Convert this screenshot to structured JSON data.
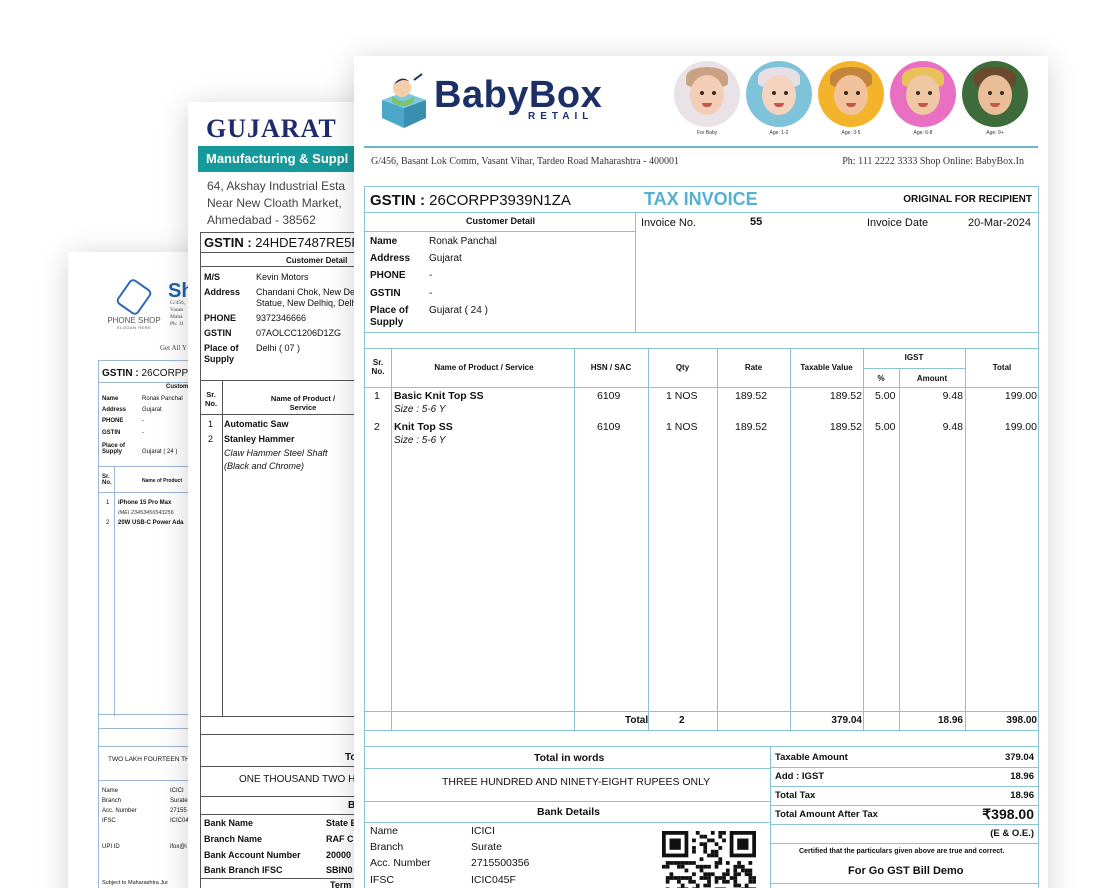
{
  "doc1": {
    "logo_text": "PHONE",
    "logo_text2": "SHOP",
    "logo_slogan": "SLOGAN HERE",
    "shop_name": "Shr",
    "addr_lines": [
      "G/456,",
      "Vasan",
      "Maha",
      "Ph: 11"
    ],
    "get_all": "Get All Y",
    "gstin_label": "GSTIN :",
    "gstin_value": "26CORPP3",
    "customer_head": "Custom",
    "fields": [
      {
        "k": "Name",
        "v": "Ronak Panchal"
      },
      {
        "k": "Address",
        "v": "Gujarat"
      },
      {
        "k": "PHONE",
        "v": "-"
      },
      {
        "k": "GSTIN",
        "v": "-"
      },
      {
        "k": "Place of Supply",
        "v": "Gujarat ( 24 )"
      }
    ],
    "col_sr": "Sr. No.",
    "col_name": "Name of Product",
    "items": [
      {
        "n": "1",
        "p": "iPhone 15 Pro Max",
        "d": "IMEI 23453456543256"
      },
      {
        "n": "2",
        "p": "20W USB-C Power Ada",
        "d": ""
      }
    ],
    "words": "TWO LAKH FOURTEEN TH",
    "bank": [
      {
        "k": "Name",
        "v": "ICICI"
      },
      {
        "k": "Branch",
        "v": "Surate"
      },
      {
        "k": "Acc. Number",
        "v": "27155"
      },
      {
        "k": "IFSC",
        "v": "ICIC04"
      },
      {
        "k": "UPI ID",
        "v": "ifox@i"
      }
    ],
    "subject": "Subject to Maharashtra Jur"
  },
  "doc2": {
    "company": "GUJARAT",
    "tagline": "Manufacturing & Suppl",
    "addr_lines": [
      "64, Akshay Industrial Esta",
      "Near New Cloath Market,",
      "Ahmedabad - 38562"
    ],
    "gstin_label": "GSTIN :",
    "gstin_value": "24HDE7487RE5F",
    "customer_head": "Customer Detail",
    "fields": [
      {
        "k": "M/S",
        "v": "Kevin Motors"
      },
      {
        "k": "Address",
        "v": "Chandani Chok, New De Statue, New Delhiq, Delh"
      },
      {
        "k": "PHONE",
        "v": "9372346666"
      },
      {
        "k": "GSTIN",
        "v": "07AOLCC1206D1ZG"
      },
      {
        "k": "Place of Supply",
        "v": "Delhi ( 07 )"
      }
    ],
    "col_sr": "Sr. No.",
    "col_name": "Name of Product / Service",
    "items": [
      {
        "n": "1",
        "p": "Automatic Saw"
      },
      {
        "n": "2",
        "p": "Stanley Hammer"
      }
    ],
    "item2_desc": [
      "Claw Hammer Steel Shaft",
      "(Black and Chrome)"
    ],
    "total_label": "To",
    "words": "ONE THOUSAND TWO HUND",
    "bank_head": "B",
    "bank": [
      {
        "k": "Bank Name",
        "v": "State E"
      },
      {
        "k": "Branch Name",
        "v": "RAF C."
      },
      {
        "k": "Bank Account Number",
        "v": "20000"
      },
      {
        "k": "Bank Branch IFSC",
        "v": "SBIN0"
      }
    ],
    "terms": "Term"
  },
  "doc3": {
    "brand": "BabyBox",
    "brand_sub": "RETAIL",
    "kids": [
      {
        "caption": "For Baby",
        "bg": "#e9e2e6",
        "skin": "#f3cdb5",
        "hair": "#c9a183"
      },
      {
        "caption": "Age: 1-2",
        "bg": "#7fc3db",
        "skin": "#f4d3bf",
        "hair": "#e8dfe6"
      },
      {
        "caption": "Age: 3-5",
        "bg": "#f3b42b",
        "skin": "#f1c29b",
        "hair": "#c5843c"
      },
      {
        "caption": "Age: 6-8",
        "bg": "#e86fc2",
        "skin": "#f0c7a3",
        "hair": "#e8c15a"
      },
      {
        "caption": "Age: 9+",
        "bg": "#3e6b3a",
        "skin": "#e9bd98",
        "hair": "#6a4a2e"
      }
    ],
    "address": "G/456, Basant Lok Comm, Vasant Vihar, Tardeo Road Maharashtra - 400001",
    "phone_line": "Ph: 111 2222 3333  Shop Online: BabyBox.In",
    "gstin_label": "GSTIN :",
    "gstin_value": "26CORPP3939N1ZA",
    "title": "TAX INVOICE",
    "original": "ORIGINAL FOR RECIPIENT",
    "customer_head": "Customer Detail",
    "invoice_no_label": "Invoice No.",
    "invoice_no": "55",
    "invoice_date_label": "Invoice Date",
    "invoice_date": "20-Mar-2024",
    "fields": [
      {
        "k": "Name",
        "v": "Ronak Panchal"
      },
      {
        "k": "Address",
        "v": "Gujarat"
      },
      {
        "k": "PHONE",
        "v": "-"
      },
      {
        "k": "GSTIN",
        "v": "-"
      },
      {
        "k": "Place of Supply",
        "v": "Gujarat ( 24 )"
      }
    ],
    "cols": {
      "sr": "Sr. No.",
      "name": "Name of Product / Service",
      "hsn": "HSN / SAC",
      "qty": "Qty",
      "rate": "Rate",
      "taxable": "Taxable Value",
      "igst": "IGST",
      "pct": "%",
      "amount": "Amount",
      "total": "Total"
    },
    "items": [
      {
        "sr": "1",
        "name": "Basic Knit Top SS",
        "size": "Size : 5-6 Y",
        "hsn": "6109",
        "qty": "1 NOS",
        "rate": "189.52",
        "taxable": "189.52",
        "pct": "5.00",
        "amount": "9.48",
        "total": "199.00"
      },
      {
        "sr": "2",
        "name": "Knit Top SS",
        "size": "Size : 5-6 Y",
        "hsn": "6109",
        "qty": "1 NOS",
        "rate": "189.52",
        "taxable": "189.52",
        "pct": "5.00",
        "amount": "9.48",
        "total": "199.00"
      }
    ],
    "totals": {
      "label": "Total",
      "qty": "2",
      "taxable": "379.04",
      "amount": "18.96",
      "total": "398.00"
    },
    "words_head": "Total in words",
    "words": "THREE HUNDRED AND NINETY-EIGHT RUPEES ONLY",
    "bank_head": "Bank Details",
    "bank": [
      {
        "k": "Name",
        "v": "ICICI"
      },
      {
        "k": "Branch",
        "v": "Surate"
      },
      {
        "k": "Acc. Number",
        "v": "2715500356"
      },
      {
        "k": "IFSC",
        "v": "ICIC045F"
      }
    ],
    "summary": [
      {
        "k": "Taxable Amount",
        "v": "379.04"
      },
      {
        "k": "Add : IGST",
        "v": "18.96"
      },
      {
        "k": "Total Tax",
        "v": "18.96"
      },
      {
        "k": "Total Amount After Tax",
        "v": "₹398.00"
      }
    ],
    "eoe": "(E & O.E.)",
    "certified": "Certified that the particulars given above are true and correct.",
    "for_company": "For Go GST Bill Demo"
  }
}
